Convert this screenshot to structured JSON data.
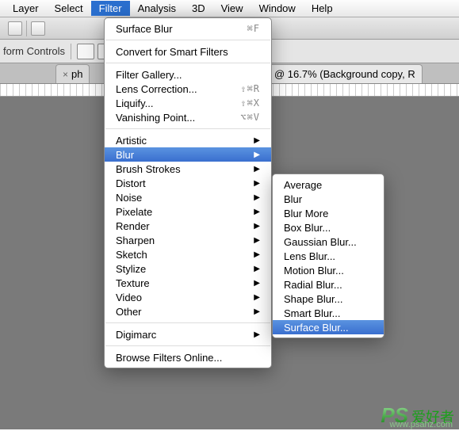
{
  "menubar": {
    "items": [
      "Layer",
      "Select",
      "Filter",
      "Analysis",
      "3D",
      "View",
      "Window",
      "Help"
    ],
    "active_index": 2
  },
  "options_label": "form Controls",
  "tab": {
    "prefix": "ph",
    "title": "538.jpeg @ 16.7% (Background copy, R",
    "close": "×"
  },
  "filter_menu": {
    "groups": [
      [
        {
          "label": "Surface Blur",
          "shortcut": "⌘F"
        }
      ],
      [
        {
          "label": "Convert for Smart Filters"
        }
      ],
      [
        {
          "label": "Filter Gallery..."
        },
        {
          "label": "Lens Correction...",
          "shortcut": "⇧⌘R"
        },
        {
          "label": "Liquify...",
          "shortcut": "⇧⌘X"
        },
        {
          "label": "Vanishing Point...",
          "shortcut": "⌥⌘V"
        }
      ],
      [
        {
          "label": "Artistic",
          "submenu": true
        },
        {
          "label": "Blur",
          "submenu": true,
          "highlight": true
        },
        {
          "label": "Brush Strokes",
          "submenu": true
        },
        {
          "label": "Distort",
          "submenu": true
        },
        {
          "label": "Noise",
          "submenu": true
        },
        {
          "label": "Pixelate",
          "submenu": true
        },
        {
          "label": "Render",
          "submenu": true
        },
        {
          "label": "Sharpen",
          "submenu": true
        },
        {
          "label": "Sketch",
          "submenu": true
        },
        {
          "label": "Stylize",
          "submenu": true
        },
        {
          "label": "Texture",
          "submenu": true
        },
        {
          "label": "Video",
          "submenu": true
        },
        {
          "label": "Other",
          "submenu": true
        }
      ],
      [
        {
          "label": "Digimarc",
          "submenu": true
        }
      ],
      [
        {
          "label": "Browse Filters Online..."
        }
      ]
    ]
  },
  "blur_submenu": {
    "items": [
      {
        "label": "Average"
      },
      {
        "label": "Blur"
      },
      {
        "label": "Blur More"
      },
      {
        "label": "Box Blur..."
      },
      {
        "label": "Gaussian Blur..."
      },
      {
        "label": "Lens Blur..."
      },
      {
        "label": "Motion Blur..."
      },
      {
        "label": "Radial Blur..."
      },
      {
        "label": "Shape Blur..."
      },
      {
        "label": "Smart Blur..."
      },
      {
        "label": "Surface Blur...",
        "highlight": true
      }
    ]
  },
  "watermark": {
    "ps": "PS",
    "cn": "爱好者",
    "url": "www.psahz.com"
  }
}
